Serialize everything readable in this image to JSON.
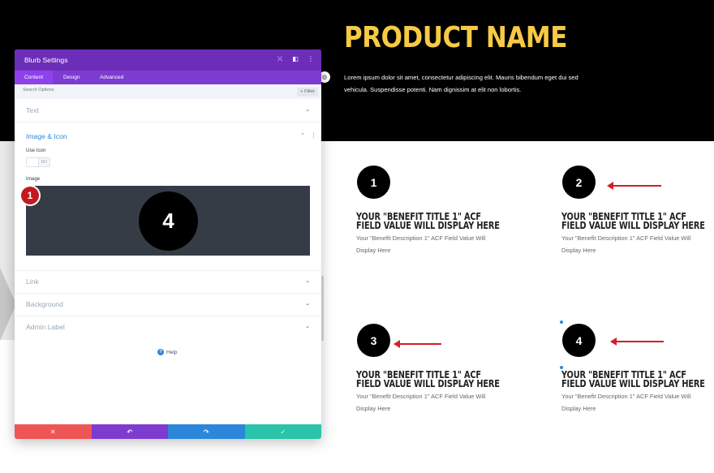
{
  "hero": {
    "product_name": "PRODUCT NAME",
    "description": "Lorem ipsum dolor sit amet, consectetur adipiscing elit. Mauris bibendum eget dui sed vehicula. Suspendisse potenti. Nam dignissim at elit non lobortis."
  },
  "benefits": [
    {
      "number": "1",
      "title": "YOUR \"BENEFIT TITLE 1\" ACF FIELD VALUE WILL DISPLAY HERE",
      "description": "Your \"Benefit Description 1\" ACF Field Value Will Display Here"
    },
    {
      "number": "2",
      "title": "YOUR \"BENEFIT TITLE 1\" ACF FIELD VALUE WILL DISPLAY HERE",
      "description": "Your \"Benefit Description 1\" ACF Field Value Will Display Here"
    },
    {
      "number": "3",
      "title": "YOUR \"BENEFIT TITLE 1\" ACF FIELD VALUE WILL DISPLAY HERE",
      "description": "Your \"Benefit Description 1\" ACF Field Value Will Display Here"
    },
    {
      "number": "4",
      "title": "YOUR \"BENEFIT TITLE 1\" ACF FIELD VALUE WILL DISPLAY HERE",
      "description": "Your \"Benefit Description 1\" ACF Field Value Will Display Here"
    }
  ],
  "panel": {
    "title": "Blurb Settings",
    "tabs": [
      "Content",
      "Design",
      "Advanced"
    ],
    "search_placeholder": "Search Options",
    "filter_label": "+ Filter",
    "sections": {
      "text": "Text",
      "image_icon": "Image & Icon",
      "link": "Link",
      "background": "Background",
      "admin_label": "Admin Label"
    },
    "use_icon_label": "Use Icon",
    "toggle_value": "NO",
    "image_label": "Image",
    "preview_number": "4",
    "help_label": "Help"
  },
  "annotation": {
    "step": "1"
  },
  "colors": {
    "accent_yellow": "#f7ca44",
    "panel_purple": "#6c2eb9",
    "arrow_red": "#d41e26",
    "cancel": "#ef5555",
    "undo": "#7e3bd0",
    "redo": "#2b87da",
    "save": "#29c4a9"
  }
}
